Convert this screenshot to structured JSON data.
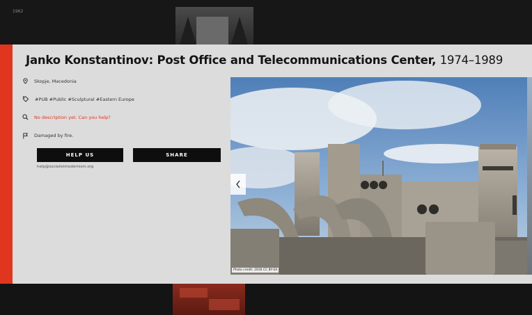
{
  "top_strip": {
    "year_label": "1962"
  },
  "modal": {
    "title_main": "Janko Konstantinov: Post Office and Telecommunications Center,",
    "title_years": "1974–1989",
    "info": {
      "location": "Skopje, Macedonia",
      "tags": "#PUB #Public #Sculptural #Eastern Europe",
      "description": "No description yet. Can you help?",
      "status": "Damaged by fire."
    },
    "buttons": {
      "help": "HELP US",
      "share": "SHARE"
    },
    "email": "help@socialistmodernism.org",
    "photo": {
      "caption": "Photo credit: 2016 CC BY-SA"
    }
  },
  "colors": {
    "accent": "#e0361f",
    "panel": "#dcdcdc",
    "button": "#0e0e0e",
    "background": "#141414"
  },
  "icons": {
    "location": "map-pin-icon",
    "tags": "tag-icon",
    "description": "search-icon",
    "status": "flag-icon",
    "prev": "chevron-left-icon"
  }
}
